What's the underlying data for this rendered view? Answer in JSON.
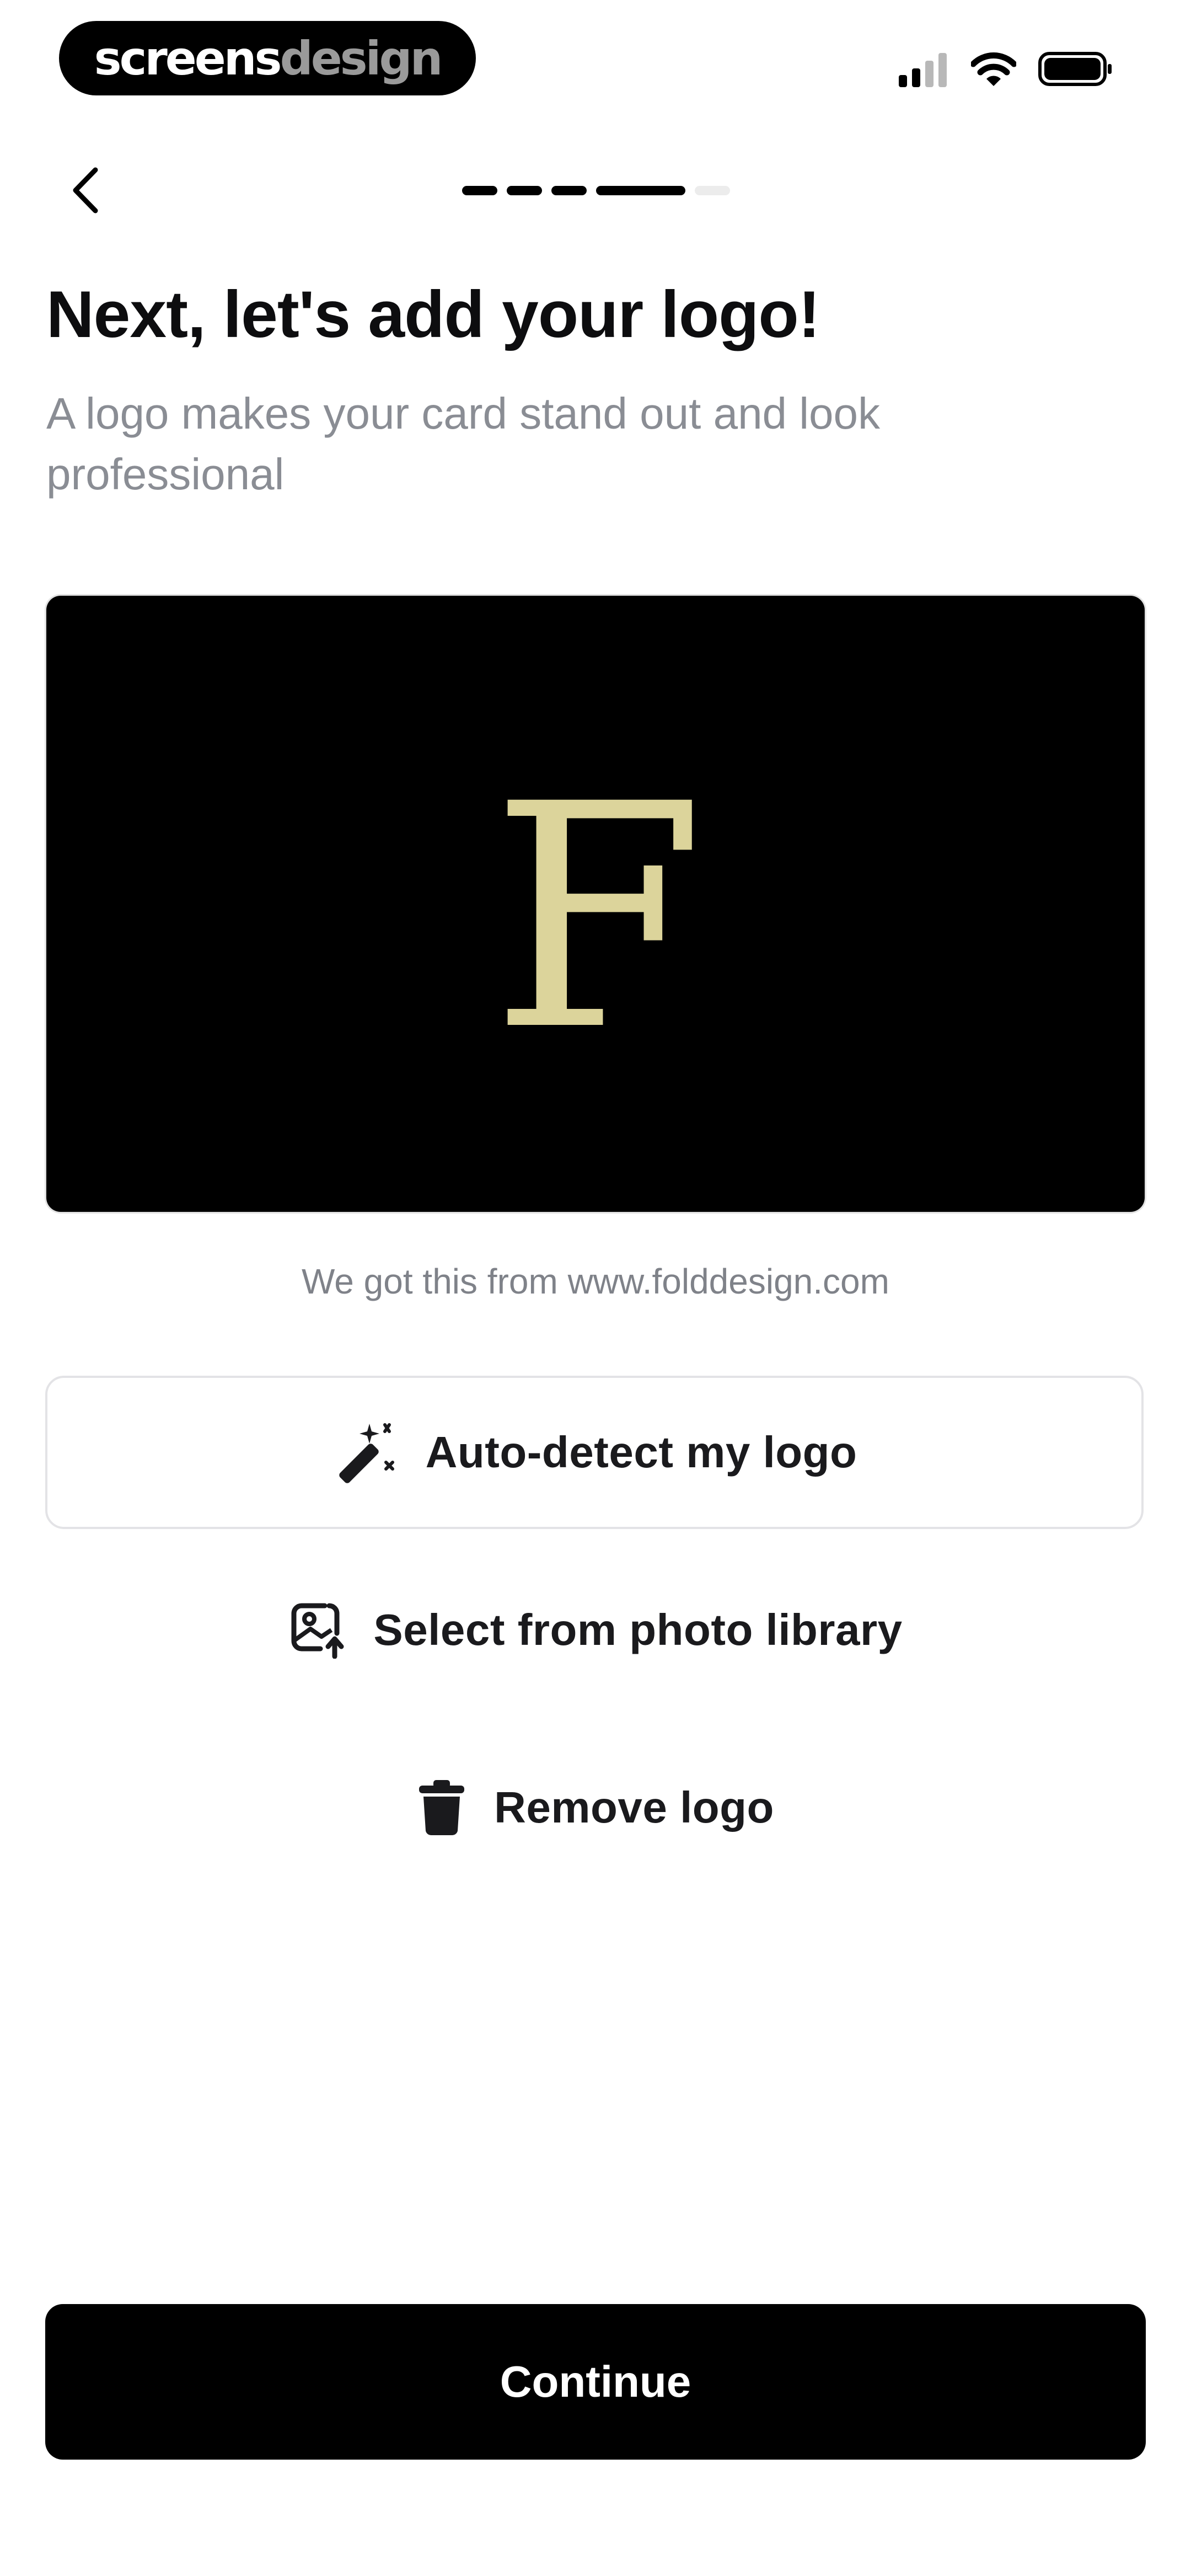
{
  "status_bar": {
    "brand_part1": "screens",
    "brand_part2": "design",
    "signal_icon": "cellular-signal-icon",
    "wifi_icon": "wifi-icon",
    "battery_icon": "battery-icon"
  },
  "nav": {
    "back_icon": "chevron-left-icon",
    "progress": {
      "total_steps": 5,
      "current_step": 4
    }
  },
  "header": {
    "title": "Next, let's add your logo!",
    "subtitle": "A logo makes your card stand out and look professional"
  },
  "card": {
    "logo_letter": "F",
    "background": "#000000",
    "logo_color": "#DCD49B",
    "source_note": "We got this from www.folddesign.com"
  },
  "actions": {
    "auto_detect": {
      "label": "Auto-detect my logo",
      "icon": "magic-wand-icon"
    },
    "photo_library": {
      "label": "Select from photo library",
      "icon": "image-upload-icon"
    },
    "remove_logo": {
      "label": "Remove logo",
      "icon": "trash-icon"
    }
  },
  "footer": {
    "continue_label": "Continue"
  },
  "colors": {
    "primary": "#000000",
    "muted_text": "#8A8D94",
    "border": "#E3E3E6"
  }
}
